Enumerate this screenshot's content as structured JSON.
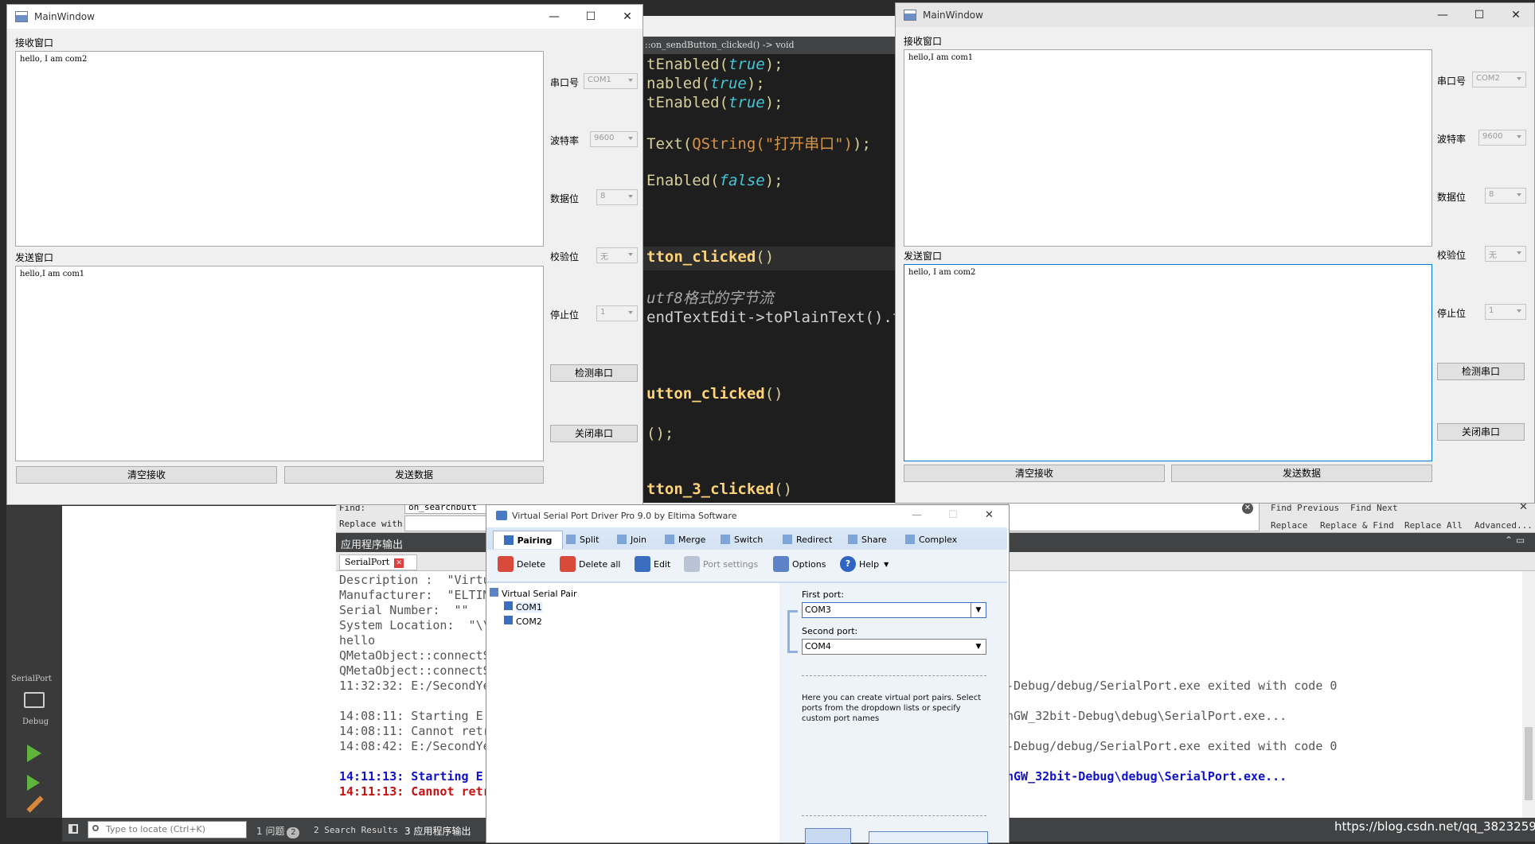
{
  "left_window": {
    "title": "MainWindow",
    "receive_label": "接收窗口",
    "receive_text": "hello, I am com2",
    "send_label": "发送窗口",
    "send_text": "hello,I am com1",
    "port_label": "串口号",
    "port_value": "COM1",
    "baud_label": "波特率",
    "baud_value": "9600",
    "data_label": "数据位",
    "data_value": "8",
    "parity_label": "校验位",
    "parity_value": "无",
    "stop_label": "停止位",
    "stop_value": "1",
    "detect_button": "检测串口",
    "close_button": "关闭串口",
    "clear_button": "清空接收",
    "send_button": "发送数据"
  },
  "right_window": {
    "title": "MainWindow",
    "receive_label": "接收窗口",
    "receive_text": "hello,I am com1",
    "send_label": "发送窗口",
    "send_text": "hello, I am com2",
    "port_label": "串口号",
    "port_value": "COM2",
    "baud_label": "波特率",
    "baud_value": "9600",
    "data_label": "数据位",
    "data_value": "8",
    "parity_label": "校验位",
    "parity_value": "无",
    "stop_label": "停止位",
    "stop_value": "1",
    "detect_button": "检测串口",
    "close_button": "关闭串口",
    "clear_button": "清空接收",
    "send_button": "发送数据"
  },
  "code": {
    "breadcrumb": "::on_sendButton_clicked() -> void",
    "l1a": "tEnabled(",
    "l1b": "true",
    "l1c": ");",
    "l2a": "nabled(",
    "l2b": "true",
    "l2c": ");",
    "l3a": "tEnabled(",
    "l3b": "true",
    "l3c": ");",
    "l4a": "Text(",
    "l4b": "QString(\"打开串口\")",
    "l4c": ");",
    "l5a": "Enabled(",
    "l5b": "false",
    "l5c": ");",
    "l6": "tton_clicked",
    "l6b": "()",
    "l7": "utf8格式的字节流",
    "l8": "endTextEdit->toPlainText().to",
    "l9": "utton_clicked",
    "l9b": "()",
    "l10": "();",
    "l11": "tton_3_clicked",
    "l11b": "()"
  },
  "creator": {
    "find_label": "Find:",
    "find_value": "on_searchbutt",
    "replace_label": "Replace with:",
    "find_previous": "Find Previous",
    "find_next": "Find Next",
    "replace": "Replace",
    "replace_find": "Replace & Find",
    "replace_all": "Replace All",
    "advanced": "Advanced...",
    "output_title": "应用程序输出",
    "output_tab": "SerialPort",
    "kit_name": "SerialPort",
    "kit_mode": "Debug",
    "out1": "Description :  \"Virtu",
    "out2": "Manufacturer:  \"ELTIM",
    "out3": "Serial Number:  \"\"",
    "out4": "System Location:  \"\\\\",
    "out5": "hello",
    "out6": "QMetaObject::connectS",
    "out7": "QMetaObject::connectS",
    "out8": "11:32:32: E:/SecondYe",
    "out9": "14:08:11: Starting E:",
    "out10": "14:08:11: Cannot retr",
    "out11": "14:08:42: E:/SecondYe",
    "out12": "14:11:13: Starting E:",
    "out13": "14:11:13: Cannot retr",
    "r1": "-Debug/debug/SerialPort.exe exited with code 0",
    "r2": "nGW_32bit-Debug\\debug\\SerialPort.exe...",
    "r3": "-Debug/debug/SerialPort.exe exited with code 0",
    "r4": "nGW_32bit-Debug\\debug\\SerialPort.exe...",
    "locate_placeholder": "Type to locate (Ctrl+K)",
    "status_issues": "1  问题",
    "status_issues_count": "2",
    "status_search": "2  Search Results",
    "status_output": "3  应用程序输出",
    "watermark": "https://blog.csdn.net/qq_3823259"
  },
  "vspd": {
    "title": "Virtual Serial Port Driver Pro 9.0 by Eltima Software",
    "tabs": [
      "Pairing",
      "Split",
      "Join",
      "Merge",
      "Switch",
      "Redirect",
      "Share",
      "Complex"
    ],
    "delete": "Delete",
    "delete_all": "Delete all",
    "edit": "Edit",
    "port_settings": "Port settings",
    "options": "Options",
    "help": "Help",
    "tree_root": "Virtual Serial Pair",
    "tree_com1": "COM1",
    "tree_com2": "COM2",
    "first_port_label": "First port:",
    "first_port_value": "COM3",
    "second_port_label": "Second port:",
    "second_port_value": "COM4",
    "hint": "Here you can create virtual port pairs. Select ports from the dropdown lists or specify custom port names"
  }
}
